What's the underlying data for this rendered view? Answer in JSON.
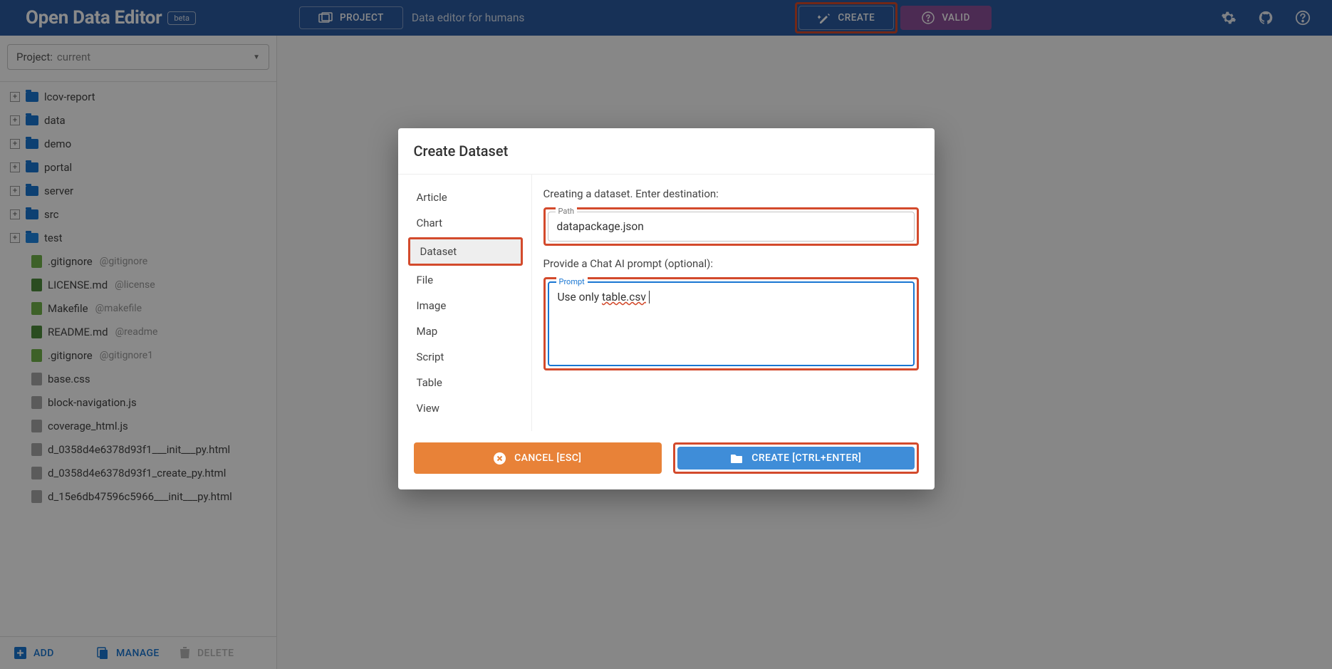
{
  "header": {
    "title": "Open Data Editor",
    "badge": "beta",
    "project_button": "PROJECT",
    "subtitle": "Data editor for humans",
    "create_button": "CREATE",
    "valid_button": "VALID"
  },
  "sidebar": {
    "project_label": "Project:",
    "project_value": "current",
    "tree_folders": [
      {
        "name": "lcov-report"
      },
      {
        "name": "data"
      },
      {
        "name": "demo"
      },
      {
        "name": "portal"
      },
      {
        "name": "server"
      },
      {
        "name": "src"
      },
      {
        "name": "test"
      }
    ],
    "tree_files": [
      {
        "name": ".gitignore",
        "annot": "@gitignore",
        "color": "green"
      },
      {
        "name": "LICENSE.md",
        "annot": "@license",
        "color": "greendark"
      },
      {
        "name": "Makefile",
        "annot": "@makefile",
        "color": "green"
      },
      {
        "name": "README.md",
        "annot": "@readme",
        "color": "greendark"
      },
      {
        "name": ".gitignore",
        "annot": "@gitignore1",
        "color": "green"
      },
      {
        "name": "base.css",
        "annot": "",
        "color": "gray"
      },
      {
        "name": "block-navigation.js",
        "annot": "",
        "color": "gray"
      },
      {
        "name": "coverage_html.js",
        "annot": "",
        "color": "gray"
      },
      {
        "name": "d_0358d4e6378d93f1___init___py.html",
        "annot": "",
        "color": "gray"
      },
      {
        "name": "d_0358d4e6378d93f1_create_py.html",
        "annot": "",
        "color": "gray"
      },
      {
        "name": "d_15e6db47596c5966___init___py.html",
        "annot": "",
        "color": "gray"
      }
    ],
    "footer": {
      "add": "ADD",
      "manage": "MANAGE",
      "delete": "DELETE"
    }
  },
  "dialog": {
    "title": "Create Dataset",
    "nav": [
      "Article",
      "Chart",
      "Dataset",
      "File",
      "Image",
      "Map",
      "Script",
      "Table",
      "View"
    ],
    "active_nav": "Dataset",
    "dest_label": "Creating a dataset. Enter destination:",
    "path": {
      "label": "Path",
      "value": "datapackage.json"
    },
    "prompt_section_label": "Provide a Chat AI prompt (optional):",
    "prompt": {
      "label": "Prompt",
      "value_prefix": "Use only ",
      "value_spellerr": "table.csv"
    },
    "cancel": "CANCEL [ESC]",
    "create": "CREATE [CTRL+ENTER]"
  }
}
